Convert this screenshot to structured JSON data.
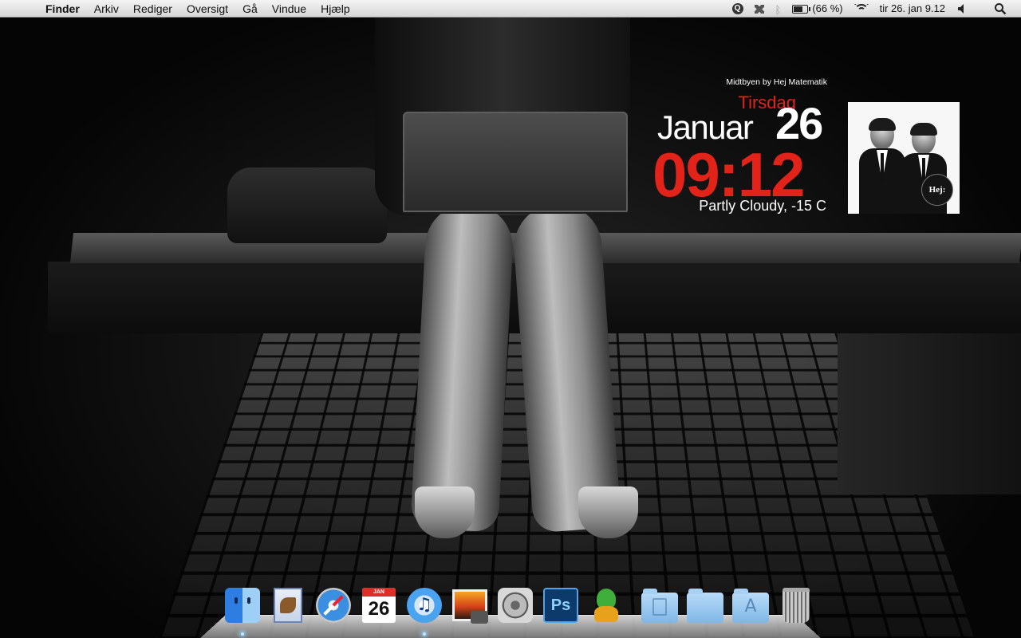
{
  "menubar": {
    "apple": "",
    "items": [
      "Finder",
      "Arkiv",
      "Rediger",
      "Oversigt",
      "Gå",
      "Vindue",
      "Hjælp"
    ],
    "status": {
      "quicksilver_icon": "q-circle-icon",
      "dropbox_icon": "dropbox-icon",
      "bluetooth_icon": "bluetooth-icon",
      "battery_percent_text": "(66 %)",
      "battery_level": 0.66,
      "wifi_icon": "wifi-icon",
      "clock": "tir 26. jan  9.12",
      "volume_icon": "volume-icon",
      "spotlight_icon": "spotlight-icon"
    }
  },
  "widget": {
    "now_playing": "Midtbyen by Hej Matematik",
    "day_name": "Tirsdag",
    "month": "Januar",
    "date": "26",
    "time": "09:12",
    "weather": "Partly Cloudy, -15 C",
    "album_badge": "Hej:"
  },
  "wallpaper": {
    "logo_glyph": ""
  },
  "dock": {
    "apps": [
      {
        "name": "finder",
        "icon": "finder-icon",
        "running": true
      },
      {
        "name": "mail",
        "icon": "mail-icon",
        "running": false
      },
      {
        "name": "safari",
        "icon": "safari-icon",
        "running": false
      },
      {
        "name": "ical",
        "icon": "calendar-icon",
        "running": false,
        "cal_month": "JAN",
        "cal_day": "26"
      },
      {
        "name": "itunes",
        "icon": "itunes-icon",
        "running": true,
        "glyph": "♫"
      },
      {
        "name": "iphoto",
        "icon": "iphoto-icon",
        "running": false
      },
      {
        "name": "system-preferences",
        "icon": "system-preferences-icon",
        "running": false
      },
      {
        "name": "photoshop",
        "icon": "photoshop-icon",
        "running": false,
        "label": "Ps"
      },
      {
        "name": "adium",
        "icon": "adium-icon",
        "running": false
      }
    ],
    "stacks": [
      {
        "name": "documents",
        "icon": "documents-folder-icon"
      },
      {
        "name": "downloads",
        "icon": "folder-icon"
      },
      {
        "name": "applications",
        "icon": "applications-folder-icon",
        "glyph": "A"
      },
      {
        "name": "trash",
        "icon": "trash-icon"
      }
    ]
  }
}
